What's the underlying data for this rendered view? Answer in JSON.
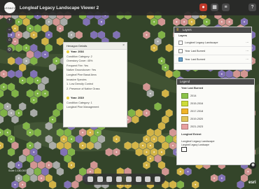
{
  "app": {
    "title": "Longleaf Legacy Landscape Viewer 2",
    "logo_text": "LEGACY",
    "header_icons": [
      "record-icon",
      "grid-icon",
      "menu-icon",
      "help-icon"
    ]
  },
  "map_controls": [
    "zoom-in-icon",
    "zoom-out-icon",
    "home-icon",
    "compass-icon"
  ],
  "popup": {
    "title": "Hexagon Details",
    "lines": [
      "Year: 2016",
      "Condition Category: 2",
      "Overstory Cover: 45%",
      "Frequent Fire: Yes",
      "Native Groundcover: Yes",
      "Longleaf Pine Basal Area",
      "Invasive Species",
      "1. Low Density Control",
      "2. Presence of Native Grass",
      "",
      "Year: 2019",
      "Condition Category: 1",
      "Longleaf Pine Management"
    ]
  },
  "layers_panel": {
    "title": "Layers",
    "subtitle": "Layers",
    "rows": [
      {
        "label": "Longleaf Legacy Landscape",
        "checked": false
      },
      {
        "label": "Year Last Burned",
        "checked": false
      },
      {
        "label": "Year Last Burned",
        "checked": true
      }
    ]
  },
  "legend_panel": {
    "title": "Legend",
    "section": "Year Last Burned",
    "items": [
      {
        "label": "2014",
        "color": "#8bc34a"
      },
      {
        "label": "2015-2016",
        "color": "#cddc39"
      },
      {
        "label": "2017-2018",
        "color": "#f0b429"
      },
      {
        "label": "2019-2020",
        "color": "#e0c55a"
      },
      {
        "label": "2021-2023",
        "color": "#e8a0a0"
      }
    ],
    "subsection": "Longleaf Extent",
    "landscape_label": "Longleaf Legacy Landscape",
    "landscape_sub": "Longleaf Legacy Landscape"
  },
  "toolbar_icons": [
    "layers-icon",
    "legend-icon",
    "bookmark-icon",
    "basemap-icon",
    "draw-icon",
    "print-icon",
    "share-icon",
    "measure-icon"
  ],
  "scale_text": "Scale 1:180,000",
  "attribution": "esri",
  "colors": {
    "header_bg": "#282828",
    "hex_green": "#8bc34a",
    "hex_yellow": "#e8c34a",
    "hex_pink": "#e8a0a0",
    "hex_purple": "#8c78c8",
    "hex_gray": "#b8b8b8"
  }
}
